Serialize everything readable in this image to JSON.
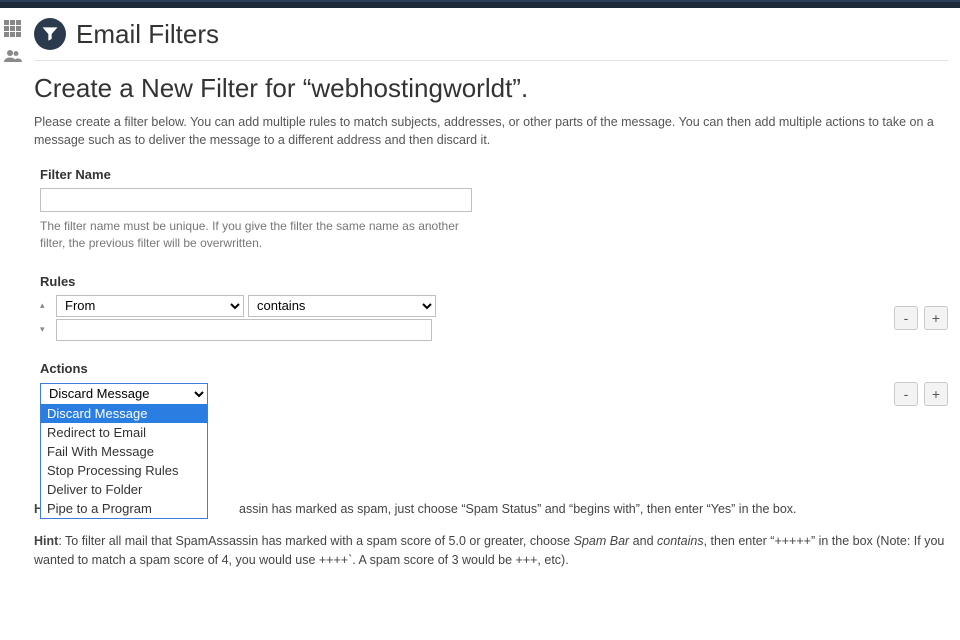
{
  "page": {
    "title": "Email Filters",
    "section_heading": "Create a New Filter for “webhostingworldt”.",
    "intro": "Please create a filter below. You can add multiple rules to match subjects, addresses, or other parts of the message. You can then add multiple actions to take on a message such as to deliver the message to a different address and then discard it."
  },
  "filter_name": {
    "label": "Filter Name",
    "value": "",
    "help": "The filter name must be unique. If you give the filter the same name as another filter, the previous filter will be overwritten."
  },
  "rules": {
    "label": "Rules",
    "field_select": "From",
    "cond_select": "contains",
    "value": ""
  },
  "actions": {
    "label": "Actions",
    "selected": "Discard Message",
    "options": [
      "Discard Message",
      "Redirect to Email",
      "Fail With Message",
      "Stop Processing Rules",
      "Deliver to Folder",
      "Pipe to a Program"
    ]
  },
  "hints": {
    "h1_prefix": "H",
    "h1_rest": "assin has marked as spam, just choose “Spam Status” and “begins with”, then enter “Yes” in the box.",
    "h2_label": "Hint",
    "h2_a": ": To filter all mail that SpamAssassin has marked with a spam score of 5.0 or greater, choose ",
    "h2_em1": "Spam Bar",
    "h2_b": " and ",
    "h2_em2": "contains",
    "h2_c": ", then enter “+++++” in the box (Note: If you wanted to match a spam score of 4, you would use ++++`. A spam score of 3 would be +++, etc)."
  },
  "buttons": {
    "minus": "-",
    "plus": "+"
  }
}
